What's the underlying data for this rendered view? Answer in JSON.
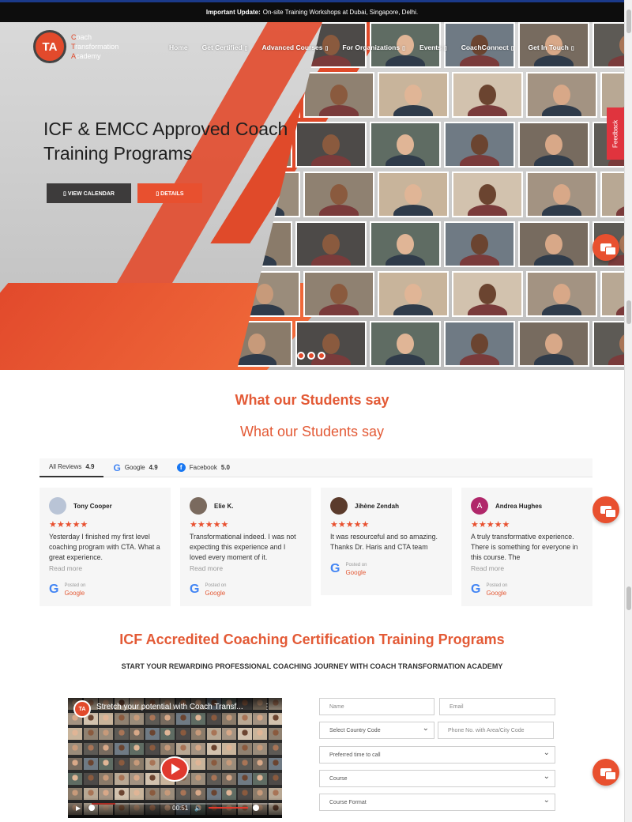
{
  "topbar": {
    "label": "Important Update:",
    "text": "On-site Training Workshops at Dubai, Singapore, Delhi."
  },
  "logo": {
    "badge": "TA",
    "lines": [
      "Coach",
      "Transformation",
      "Academy"
    ]
  },
  "nav": [
    {
      "label": "Home",
      "caret": ""
    },
    {
      "label": "Get Certified",
      "caret": "▯"
    },
    {
      "label": "Advanced Courses",
      "caret": "▯"
    },
    {
      "label": "For Organizations",
      "caret": "▯"
    },
    {
      "label": "Events",
      "caret": "▯"
    },
    {
      "label": "CoachConnect",
      "caret": "▯"
    },
    {
      "label": "Get In Touch",
      "caret": "▯"
    }
  ],
  "hero": {
    "title": "ICF & EMCC Approved Coach Training Programs",
    "btn_calendar": "▯ VIEW CALENDAR",
    "btn_details": "▯ DETAILS"
  },
  "feedback_tab": "Feedback",
  "students": {
    "heading_1": "What our Students say",
    "heading_2": "What our Students say",
    "tabs": [
      {
        "label": "All Reviews",
        "score": "4.9"
      },
      {
        "label": "Google",
        "score": "4.9"
      },
      {
        "label": "Facebook",
        "score": "5.0"
      }
    ],
    "reviews": [
      {
        "name": "Tony Cooper",
        "avatar": "",
        "stars": "★★★★★",
        "text": "Yesterday I finished my first level coaching program with CTA. What a great experience.",
        "read_more": "Read more",
        "posted_on": "Posted on",
        "source": "Google"
      },
      {
        "name": "Elie K.",
        "avatar": "",
        "stars": "★★★★★",
        "text": "Transformational indeed. I was not expecting this experience and I loved every moment of it.",
        "read_more": "Read more",
        "posted_on": "Posted on",
        "source": "Google"
      },
      {
        "name": "Jihène Zendah",
        "avatar": "",
        "stars": "★★★★★",
        "text": "It was resourceful and so amazing. Thanks Dr. Haris and CTA team",
        "read_more": "",
        "posted_on": "Posted on",
        "source": "Google"
      },
      {
        "name": "Andrea Hughes",
        "avatar": "A",
        "stars": "★★★★★",
        "text": "A truly transformative experience. There is something for everyone in this course. The",
        "read_more": "Read more",
        "posted_on": "Posted on",
        "source": "Google"
      }
    ]
  },
  "icf": {
    "heading": "ICF Accredited Coaching Certification Training Programs",
    "subheading": "START YOUR REWARDING PROFESSIONAL COACHING JOURNEY WITH COACH TRANSFORMATION ACADEMY"
  },
  "video": {
    "logo": "TA",
    "title": "Stretch your potential with Coach Transf...",
    "menu": "⋮",
    "time": "00:51",
    "progress": 0.13
  },
  "form": {
    "name_placeholder": "Name",
    "email_placeholder": "Email",
    "country_code": "Select Country Code",
    "phone_placeholder": "Phone No. with Area/City Code",
    "preferred_time": "Preferred time to call",
    "course": "Course",
    "course_format": "Course Format"
  },
  "colors": {
    "accent": "#e8502f",
    "dark": "#0d0d0d",
    "heading": "#e35a36"
  }
}
